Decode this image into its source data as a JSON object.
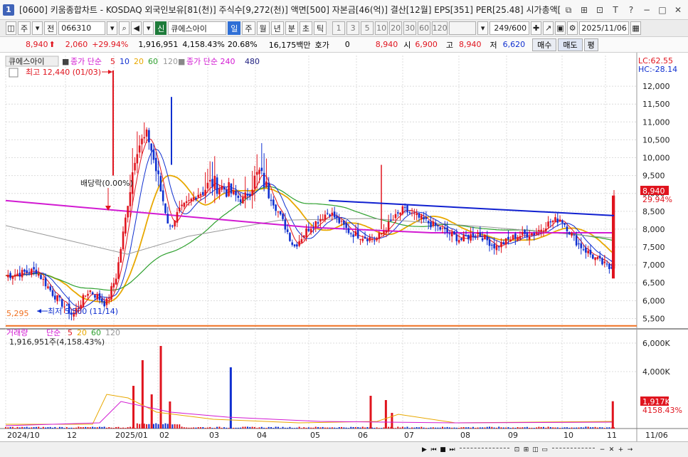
{
  "window": {
    "number": "1",
    "title": "[0600] 키움종합차트 - KOSDAQ 외국인보유[81(천)] 주식수[9,272(천)] 액면[500] 자본금[46(억)] 결산[12월] EPS[351] PER[25.48] 시가총액["
  },
  "toolbar": {
    "period_unit": "주",
    "prev_label": "전",
    "code": "066310",
    "new_badge": "신",
    "stock_name": "큐에스아이",
    "periods": [
      "일",
      "주",
      "월",
      "년",
      "분",
      "초",
      "틱"
    ],
    "minute_intervals": [
      "1",
      "3",
      "5",
      "10",
      "20",
      "30",
      "60",
      "120"
    ],
    "count": "249/600",
    "date": "2025/11/06"
  },
  "quote": {
    "price": "8,940",
    "change": "2,060",
    "change_pct": "+29.94%",
    "volume": "1,916,951",
    "volume_ratio": "4,158.43%",
    "turnover": "20.68%",
    "amount": "16,175백만",
    "ask_label": "호가",
    "ask_value": "0",
    "bid_value": "8,940",
    "open_label": "시",
    "open": "6,900",
    "high_label": "고",
    "high": "8,940",
    "low_label": "저",
    "low": "6,620",
    "buy_label": "매수",
    "sell_label": "매도",
    "avg_label": "평"
  },
  "legend": {
    "stock": "큐에스아이",
    "ma_title": "종가 단순",
    "ma_periods": [
      "5",
      "10",
      "20",
      "60",
      "120"
    ],
    "ma2_title": "종가 단순 240",
    "ma2_period": "480",
    "lc": "LC:62.55",
    "hc": "HC:-28.14"
  },
  "annotations": {
    "high_label": "최고 12,440 (01/03)",
    "low_label": "최저 5,500 (11/14)",
    "dividend": "배당락(0.00%)",
    "low_line": "5,295",
    "price_tag": "8,940",
    "pct_tag": "29.94%"
  },
  "volume_panel": {
    "title": "거래량",
    "ma_title": "단순",
    "ma_periods": [
      "5",
      "20",
      "60",
      "120"
    ],
    "value": "1,916,951주(4,158.43%)",
    "tag": "1,917K",
    "tag_pct": "4158.43%"
  },
  "colors": {
    "up": "#e0141e",
    "down": "#1030d0",
    "ma5": "#e0141e",
    "ma10": "#1030d0",
    "ma20": "#e8a800",
    "ma60": "#2ea02e",
    "ma120": "#999999",
    "ma240": "#d21ad2",
    "ma480": "#202080",
    "trend": "#1020d0",
    "low_line": "#f07020"
  },
  "chart_data": {
    "type": "candlestick",
    "price_axis": {
      "ticks": [
        5500,
        6000,
        6500,
        7000,
        7500,
        8000,
        8500,
        9000,
        9500,
        10000,
        10500,
        11000,
        11500,
        12000
      ],
      "range": [
        5250,
        12500
      ]
    },
    "volume_axis": {
      "ticks": [
        4000,
        6000
      ],
      "unit": "K",
      "range": [
        0,
        7000
      ]
    },
    "x_ticks": [
      "2024/10",
      "12",
      "2025/01",
      "02",
      "03",
      "04",
      "05",
      "06",
      "07",
      "08",
      "09",
      "10",
      "11",
      "11/06"
    ],
    "anchors": [
      {
        "date": "2024/10/02",
        "price": 6700
      },
      {
        "date": "2024/10/21",
        "price": 6850
      },
      {
        "date": "2024/11/01",
        "price": 6200
      },
      {
        "date": "2024/11/14",
        "price": 5600
      },
      {
        "date": "2024/11/25",
        "price": 6300
      },
      {
        "date": "2024/12/06",
        "price": 5900
      },
      {
        "date": "2024/12/13",
        "price": 6700
      },
      {
        "date": "2024/12/19",
        "price": 8300
      },
      {
        "date": "2024/12/26",
        "price": 10300
      },
      {
        "date": "2025/01/03",
        "price": 10600
      },
      {
        "date": "2025/01/10",
        "price": 9300
      },
      {
        "date": "2025/01/17",
        "price": 8000
      },
      {
        "date": "2025/01/23",
        "price": 8500
      },
      {
        "date": "2025/02/05",
        "price": 9000
      },
      {
        "date": "2025/02/14",
        "price": 9300
      },
      {
        "date": "2025/02/24",
        "price": 9100
      },
      {
        "date": "2025/03/06",
        "price": 8800
      },
      {
        "date": "2025/03/17",
        "price": 9600
      },
      {
        "date": "2025/03/26",
        "price": 8800
      },
      {
        "date": "2025/04/04",
        "price": 8000
      },
      {
        "date": "2025/04/09",
        "price": 7500
      },
      {
        "date": "2025/04/18",
        "price": 8000
      },
      {
        "date": "2025/05/02",
        "price": 8500
      },
      {
        "date": "2025/05/16",
        "price": 7900
      },
      {
        "date": "2025/06/02",
        "price": 7700
      },
      {
        "date": "2025/06/12",
        "price": 8200
      },
      {
        "date": "2025/06/20",
        "price": 8550
      },
      {
        "date": "2025/07/01",
        "price": 8300
      },
      {
        "date": "2025/07/15",
        "price": 8000
      },
      {
        "date": "2025/07/28",
        "price": 7700
      },
      {
        "date": "2025/08/08",
        "price": 7900
      },
      {
        "date": "2025/08/20",
        "price": 7500
      },
      {
        "date": "2025/09/02",
        "price": 7800
      },
      {
        "date": "2025/09/15",
        "price": 7900
      },
      {
        "date": "2025/09/25",
        "price": 8200
      },
      {
        "date": "2025/10/02",
        "price": 8300
      },
      {
        "date": "2025/10/13",
        "price": 7600
      },
      {
        "date": "2025/10/24",
        "price": 7200
      },
      {
        "date": "2025/11/03",
        "price": 6900
      },
      {
        "date": "2025/11/05",
        "price": 6900
      },
      {
        "date": "2025/11/06",
        "price": 8940
      }
    ],
    "ma240_anchors": [
      [
        0,
        8800
      ],
      [
        0.3,
        8350
      ],
      [
        0.5,
        8050
      ],
      [
        0.7,
        7900
      ],
      [
        1,
        7900
      ]
    ],
    "ma120_anchors": [
      [
        0,
        8100
      ],
      [
        0.1,
        7700
      ],
      [
        0.2,
        7300
      ],
      [
        0.3,
        7800
      ],
      [
        0.45,
        8250
      ],
      [
        0.6,
        8300
      ],
      [
        0.8,
        8050
      ],
      [
        1,
        7750
      ]
    ],
    "volume_spikes": [
      {
        "x": 0.21,
        "v": 3000
      },
      {
        "x": 0.225,
        "v": 4800
      },
      {
        "x": 0.24,
        "v": 2400
      },
      {
        "x": 0.255,
        "v": 5800
      },
      {
        "x": 0.37,
        "v": 4300
      },
      {
        "x": 0.27,
        "v": 1900
      },
      {
        "x": 0.6,
        "v": 2300
      },
      {
        "x": 0.625,
        "v": 2000
      },
      {
        "x": 0.635,
        "v": 1100
      },
      {
        "x": 0.998,
        "v": 1917
      }
    ],
    "trendline": {
      "from": {
        "date": "2025/05/02",
        "price": 8800
      },
      "to": {
        "date": "2025/11/06",
        "price": 8380
      }
    },
    "low_line": 5295
  }
}
